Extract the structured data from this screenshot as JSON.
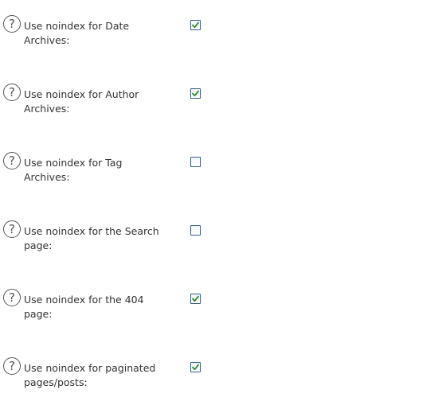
{
  "colors": {
    "checkbox_border": "#3a5a8a",
    "checkmark": "#2e8b2e",
    "label_text": "#333333",
    "help_icon": "#555555"
  },
  "help_icon": {
    "icon": "question-circle-icon",
    "glyph": "?"
  },
  "settings": [
    {
      "label": "Use noindex for Date Archives:",
      "checked": true
    },
    {
      "label": "Use noindex for Author Archives:",
      "checked": true
    },
    {
      "label": "Use noindex for Tag Archives:",
      "checked": false
    },
    {
      "label": "Use noindex for the Search page:",
      "checked": false
    },
    {
      "label": "Use noindex for the 404 page:",
      "checked": true
    },
    {
      "label": "Use noindex for paginated pages/posts:",
      "checked": true
    }
  ]
}
